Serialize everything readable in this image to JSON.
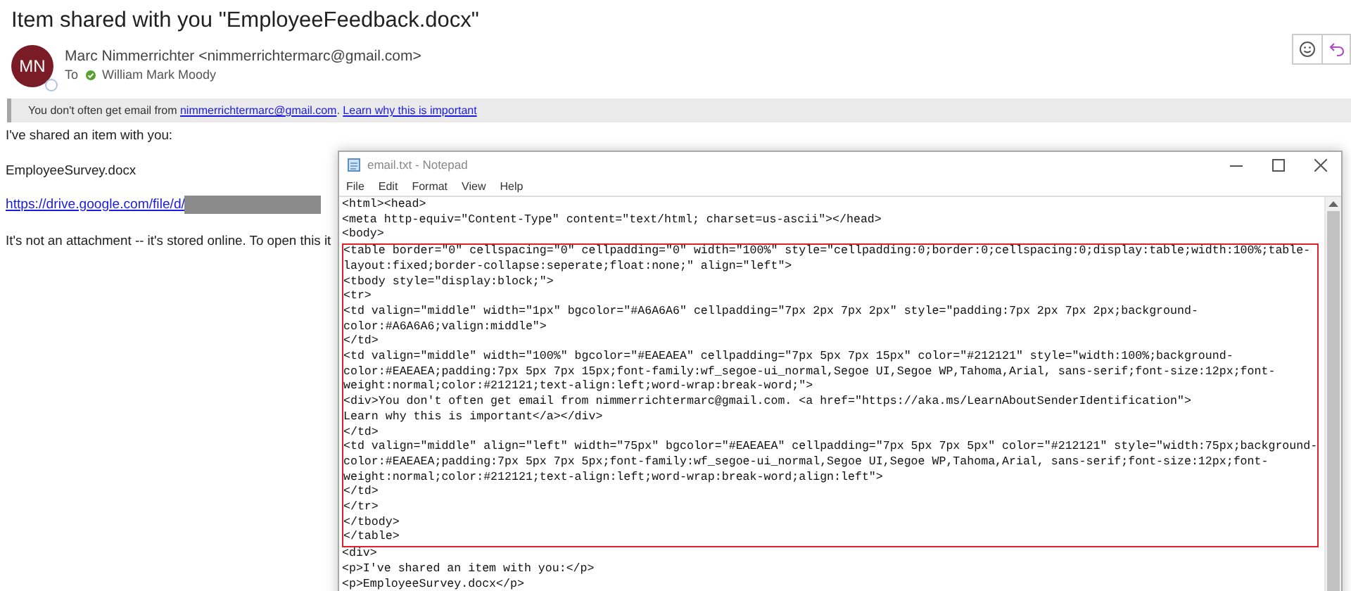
{
  "email": {
    "subject": "Item shared with you \"EmployeeFeedback.docx\"",
    "avatar_initials": "MN",
    "sender": "Marc Nimmerrichter <nimmerrichtermarc@gmail.com>",
    "to_label": "To",
    "recipient": "William Mark Moody",
    "banner": {
      "text": "You don't often get email from ",
      "link": "nimmerrichtermarc@gmail.com",
      "separator": ". ",
      "link2": "Learn why this is important"
    },
    "body": [
      {
        "kind": "text",
        "text": "I've shared an item with you:"
      },
      {
        "kind": "text",
        "text": "EmployeeSurvey.docx"
      },
      {
        "kind": "link",
        "text": "https://drive.google.com/file/d/",
        "redacted": true
      },
      {
        "kind": "text",
        "text": "It's not an attachment -- it's stored online. To open this it"
      }
    ]
  },
  "notepad": {
    "title": "email.txt - Notepad",
    "menu": [
      "File",
      "Edit",
      "Format",
      "View",
      "Help"
    ],
    "lines": [
      {
        "text": "<html><head>",
        "highlighted": false
      },
      {
        "text": "<meta http-equiv=\"Content-Type\" content=\"text/html; charset=us-ascii\"></head>",
        "highlighted": false
      },
      {
        "text": "<body>",
        "highlighted": false
      },
      {
        "text": "<table border=\"0\" cellspacing=\"0\" cellpadding=\"0\" width=\"100%\" style=\"cellpadding:0;border:0;cellspacing:0;display:table;width:100%;table-",
        "highlighted": true
      },
      {
        "text": "layout:fixed;border-collapse:seperate;float:none;\" align=\"left\">",
        "highlighted": true
      },
      {
        "text": "<tbody style=\"display:block;\">",
        "highlighted": true
      },
      {
        "text": "<tr>",
        "highlighted": true
      },
      {
        "text": "<td valign=\"middle\" width=\"1px\" bgcolor=\"#A6A6A6\" cellpadding=\"7px 2px 7px 2px\" style=\"padding:7px 2px 7px 2px;background-",
        "highlighted": true
      },
      {
        "text": "color:#A6A6A6;valign:middle\">",
        "highlighted": true
      },
      {
        "text": "</td>",
        "highlighted": true
      },
      {
        "text": "<td valign=\"middle\" width=\"100%\" bgcolor=\"#EAEAEA\" cellpadding=\"7px 5px 7px 15px\" color=\"#212121\" style=\"width:100%;background-",
        "highlighted": true
      },
      {
        "text": "color:#EAEAEA;padding:7px 5px 7px 15px;font-family:wf_segoe-ui_normal,Segoe UI,Segoe WP,Tahoma,Arial, sans-serif;font-size:12px;font-",
        "highlighted": true
      },
      {
        "text": "weight:normal;color:#212121;text-align:left;word-wrap:break-word;\">",
        "highlighted": true
      },
      {
        "text": "<div>You don't often get email from nimmerrichtermarc@gmail.com. <a href=\"https://aka.ms/LearnAboutSenderIdentification\">",
        "highlighted": true
      },
      {
        "text": "Learn why this is important</a></div>",
        "highlighted": true
      },
      {
        "text": "</td>",
        "highlighted": true
      },
      {
        "text": "<td valign=\"middle\" align=\"left\" width=\"75px\" bgcolor=\"#EAEAEA\" cellpadding=\"7px 5px 7px 5px\" color=\"#212121\" style=\"width:75px;background-",
        "highlighted": true
      },
      {
        "text": "color:#EAEAEA;padding:7px 5px 7px 5px;font-family:wf_segoe-ui_normal,Segoe UI,Segoe WP,Tahoma,Arial, sans-serif;font-size:12px;font-",
        "highlighted": true
      },
      {
        "text": "weight:normal;color:#212121;text-align:left;word-wrap:break-word;align:left\">",
        "highlighted": true
      },
      {
        "text": "</td>",
        "highlighted": true
      },
      {
        "text": "</tr>",
        "highlighted": true
      },
      {
        "text": "</tbody>",
        "highlighted": true
      },
      {
        "text": "</table>",
        "highlighted": true
      },
      {
        "text": "<div>",
        "highlighted": false
      },
      {
        "text": "<p>I've shared an item with you:</p>",
        "highlighted": false
      },
      {
        "text": "<p>EmployeeSurvey.docx</p>",
        "highlighted": false
      }
    ]
  }
}
